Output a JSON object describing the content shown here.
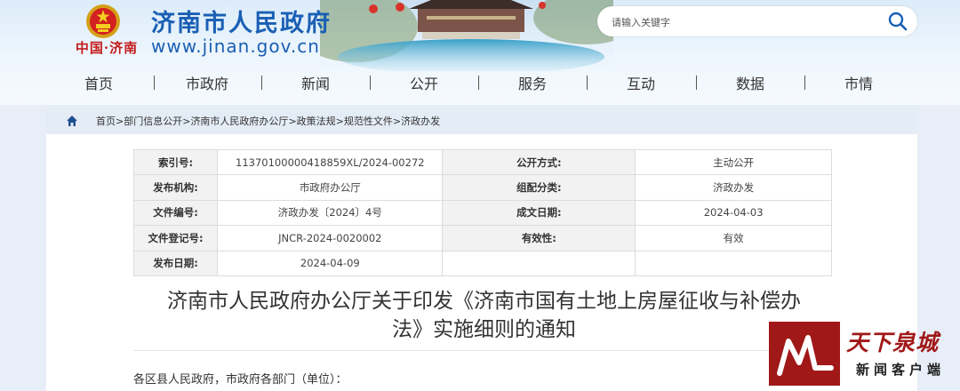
{
  "header": {
    "site_title": "济南市人民政府",
    "site_url": "www.jinan.gov.cn",
    "logo_text": "中国·济南",
    "search_placeholder": "请输入关键字"
  },
  "nav": {
    "items": [
      "首页",
      "市政府",
      "新闻",
      "公开",
      "服务",
      "互动",
      "数据",
      "市情"
    ]
  },
  "breadcrumb": {
    "items": [
      "首页",
      "部门信息公开",
      "济南市人民政府办公厅",
      "政策法规",
      "规范性文件",
      "济政办发"
    ],
    "separator": ">"
  },
  "info": {
    "index_no_label": "索引号:",
    "index_no": "11370100000418859XL/2024-00272",
    "disclosure_label": "公开方式:",
    "disclosure": "主动公开",
    "issuer_label": "发布机构:",
    "issuer": "市政府办公厅",
    "category_label": "组配分类:",
    "category": "济政办发",
    "doc_no_label": "文件编号:",
    "doc_no": "济政办发〔2024〕4号",
    "created_label": "成文日期:",
    "created": "2024-04-03",
    "reg_no_label": "文件登记号:",
    "reg_no": "JNCR-2024-0020002",
    "validity_label": "有效性:",
    "validity": "有效",
    "published_label": "发布日期:",
    "published": "2024-04-09"
  },
  "document": {
    "title_line1": "济南市人民政府办公厅关于印发《济南市国有土地上房屋征收与补偿办",
    "title_line2": "法》实施细则的通知",
    "salutation": "各区县人民政府，市政府各部门（单位）："
  },
  "watermark": {
    "calligraphy": "天下泉城",
    "subtitle": "新闻客户端"
  },
  "colors": {
    "brand_blue": "#1a5fb4",
    "logo_red": "#c41c1c",
    "watermark_red": "#a11818"
  }
}
